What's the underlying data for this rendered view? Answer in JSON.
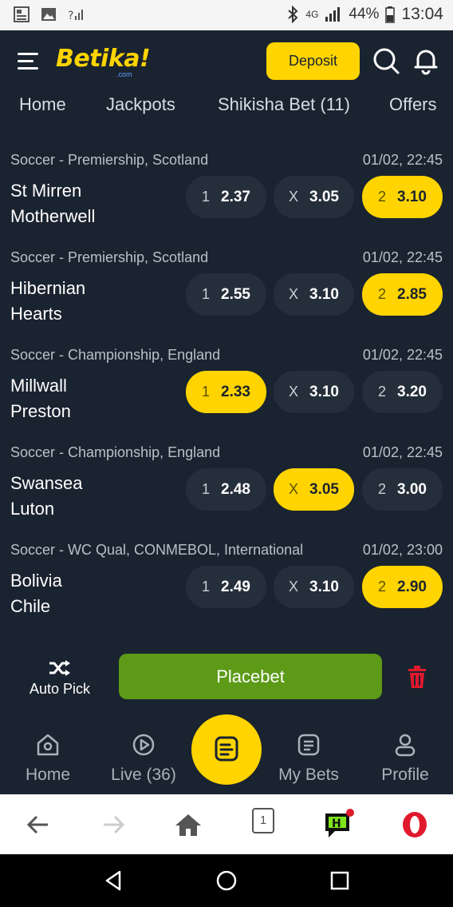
{
  "status_bar": {
    "network": "4G",
    "battery": "44%",
    "time": "13:04"
  },
  "header": {
    "logo": "Betika!",
    "logo_sub": ".com",
    "deposit_label": "Deposit"
  },
  "tabs": [
    {
      "label": "Home"
    },
    {
      "label": "Jackpots"
    },
    {
      "label": "Shikisha Bet (11)"
    },
    {
      "label": "Offers"
    }
  ],
  "matches": [
    {
      "league": "Soccer - Premiership, Scotland",
      "date": "01/02, 22:45",
      "home": "St Mirren",
      "away": "Motherwell",
      "odds": [
        {
          "key": "1",
          "value": "2.37",
          "selected": false
        },
        {
          "key": "X",
          "value": "3.05",
          "selected": false
        },
        {
          "key": "2",
          "value": "3.10",
          "selected": true
        }
      ]
    },
    {
      "league": "Soccer - Premiership, Scotland",
      "date": "01/02, 22:45",
      "home": "Hibernian",
      "away": "Hearts",
      "odds": [
        {
          "key": "1",
          "value": "2.55",
          "selected": false
        },
        {
          "key": "X",
          "value": "3.10",
          "selected": false
        },
        {
          "key": "2",
          "value": "2.85",
          "selected": true
        }
      ]
    },
    {
      "league": "Soccer - Championship, England",
      "date": "01/02, 22:45",
      "home": "Millwall",
      "away": "Preston",
      "odds": [
        {
          "key": "1",
          "value": "2.33",
          "selected": true
        },
        {
          "key": "X",
          "value": "3.10",
          "selected": false
        },
        {
          "key": "2",
          "value": "3.20",
          "selected": false
        }
      ]
    },
    {
      "league": "Soccer - Championship, England",
      "date": "01/02, 22:45",
      "home": "Swansea",
      "away": "Luton",
      "odds": [
        {
          "key": "1",
          "value": "2.48",
          "selected": false
        },
        {
          "key": "X",
          "value": "3.05",
          "selected": true
        },
        {
          "key": "2",
          "value": "3.00",
          "selected": false
        }
      ]
    },
    {
      "league": "Soccer - WC Qual, CONMEBOL, International",
      "date": "01/02, 23:00",
      "home": "Bolivia",
      "away": "Chile",
      "odds": [
        {
          "key": "1",
          "value": "2.49",
          "selected": false
        },
        {
          "key": "X",
          "value": "3.10",
          "selected": false
        },
        {
          "key": "2",
          "value": "2.90",
          "selected": true
        }
      ]
    }
  ],
  "betslip_bar": {
    "auto_pick_label": "Auto Pick",
    "placebet_label": "Placebet"
  },
  "bottom_nav": [
    {
      "label": "Home",
      "icon": "home-icon"
    },
    {
      "label": "Live (36)",
      "icon": "play-circle-icon"
    },
    {
      "label": "My Bets",
      "icon": "list-icon"
    },
    {
      "label": "Profile",
      "icon": "user-icon"
    }
  ],
  "browser_bar": {
    "tab_count": "1"
  },
  "colors": {
    "background": "#1a2330",
    "accent": "#ffd400",
    "odd_button": "#252f3b",
    "placebet": "#5c9a17",
    "trash": "#e0192d"
  }
}
